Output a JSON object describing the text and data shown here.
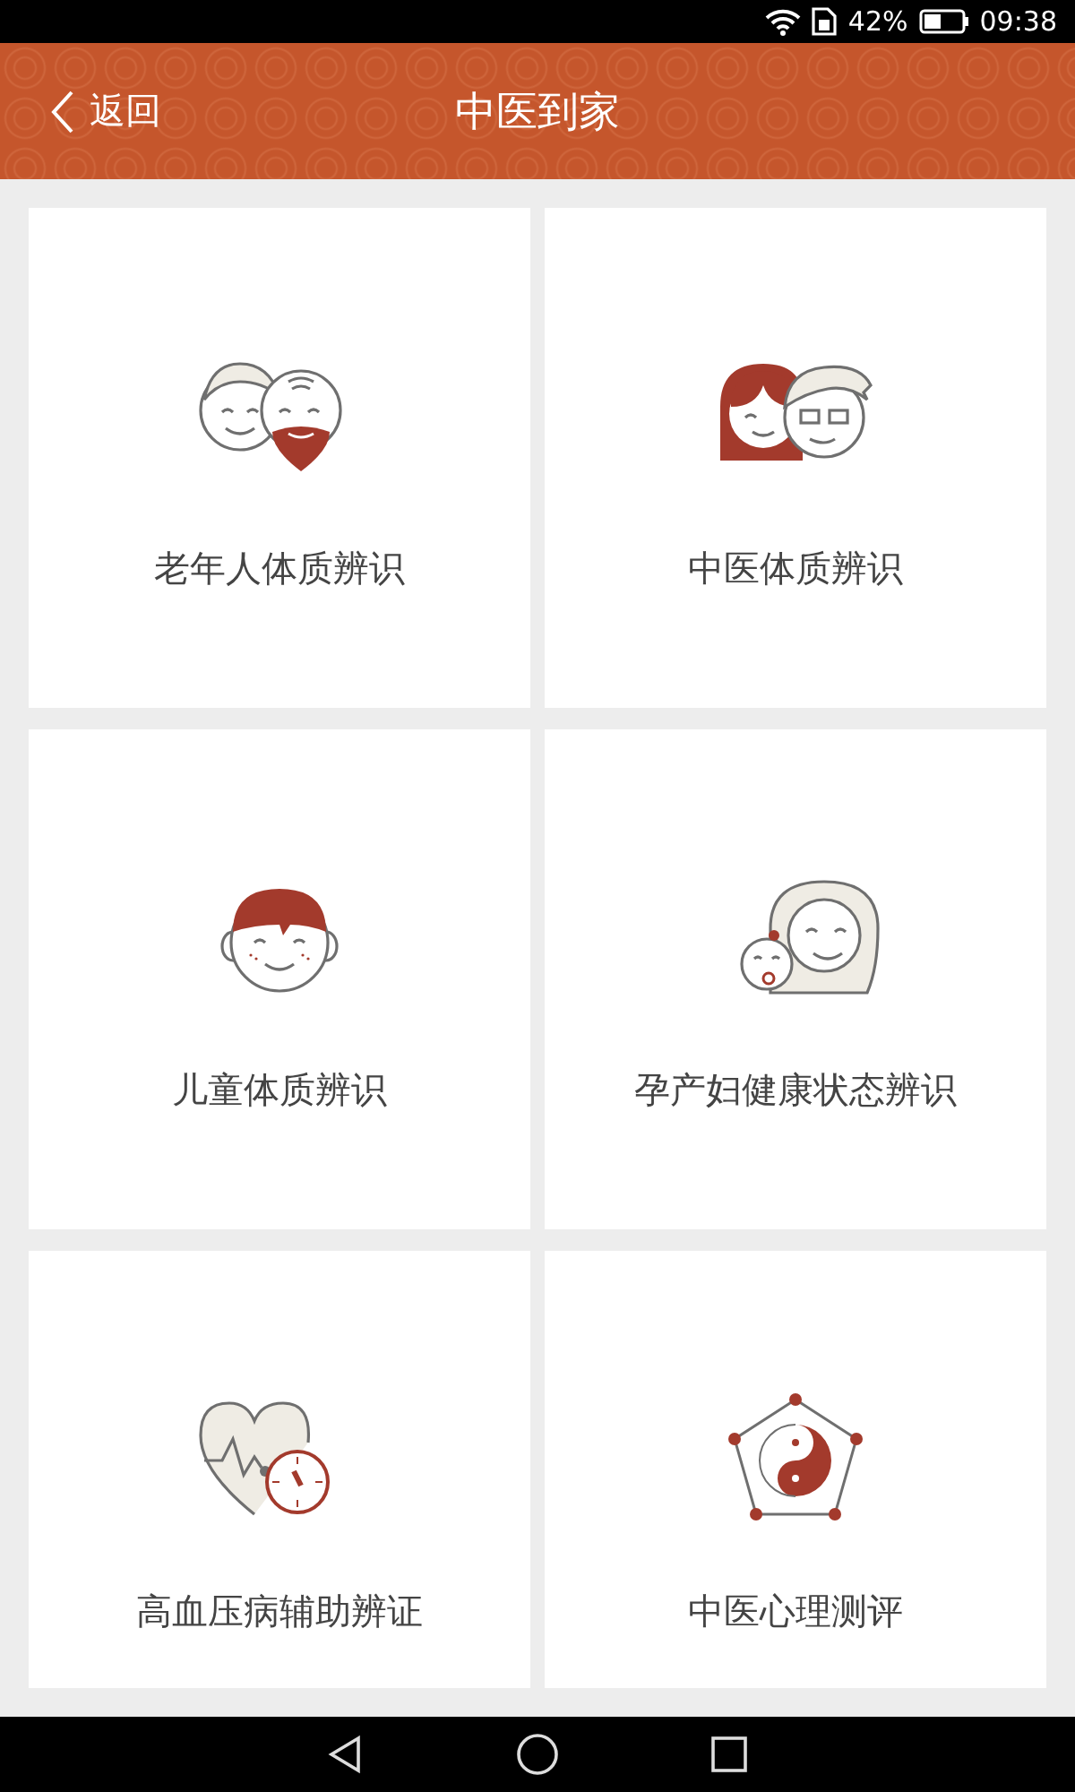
{
  "status_bar": {
    "battery": "42%",
    "time": "09:38"
  },
  "header": {
    "back": "返回",
    "title": "中医到家"
  },
  "cards": [
    {
      "kind": "elderly",
      "label": "老年人体质辨识"
    },
    {
      "kind": "couple",
      "label": "中医体质辨识"
    },
    {
      "kind": "child",
      "label": "儿童体质辨识"
    },
    {
      "kind": "mother",
      "label": "孕产妇健康状态辨识"
    },
    {
      "kind": "heart",
      "label": "高血压病辅助辨证"
    },
    {
      "kind": "yinyang",
      "label": "中医心理测评"
    }
  ]
}
